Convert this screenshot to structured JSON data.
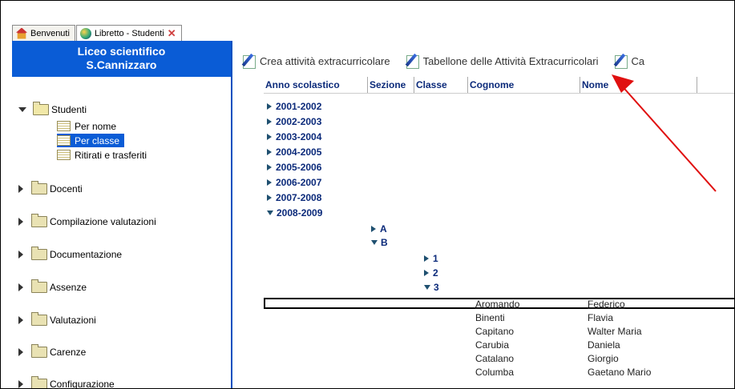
{
  "tabs": [
    {
      "label": "Benvenuti",
      "icon": "house-icon"
    },
    {
      "label": "Libretto - Studenti",
      "icon": "globe-icon",
      "close": "✕"
    }
  ],
  "school": {
    "line1": "Liceo scientifico",
    "line2": "S.Cannizzaro"
  },
  "tree": {
    "studenti": "Studenti",
    "per_nome": "Per nome",
    "per_classe": "Per classe",
    "ritirati": "Ritirati e trasferiti",
    "docenti": "Docenti",
    "compilazione": "Compilazione valutazioni",
    "documentazione": "Documentazione",
    "assenze": "Assenze",
    "valutazioni": "Valutazioni",
    "carenze": "Carenze",
    "configurazione": "Configurazione"
  },
  "toolbar": {
    "crea": "Crea attività extracurricolare",
    "tabellone": "Tabellone delle Attività Extracurricolari",
    "third": "Ca"
  },
  "grid": {
    "headers": [
      "Anno scolastico",
      "Sezione",
      "Classe",
      "Cognome",
      "Nome"
    ],
    "years": [
      "2001-2002",
      "2002-2003",
      "2003-2004",
      "2004-2005",
      "2005-2006",
      "2006-2007",
      "2007-2008",
      "2008-2009"
    ],
    "sections": [
      "A",
      "B"
    ],
    "classes": [
      "1",
      "2",
      "3"
    ],
    "students": [
      {
        "cognome": "Aromando",
        "nome": "Federico"
      },
      {
        "cognome": "Binenti",
        "nome": "Flavia"
      },
      {
        "cognome": "Capitano",
        "nome": "Walter Maria"
      },
      {
        "cognome": "Carubia",
        "nome": "Daniela"
      },
      {
        "cognome": "Catalano",
        "nome": "Giorgio"
      },
      {
        "cognome": "Columba",
        "nome": "Gaetano Mario"
      }
    ]
  },
  "colors": {
    "header_blue": "#0a5cd6",
    "annotation_arrow": "#e01010"
  }
}
